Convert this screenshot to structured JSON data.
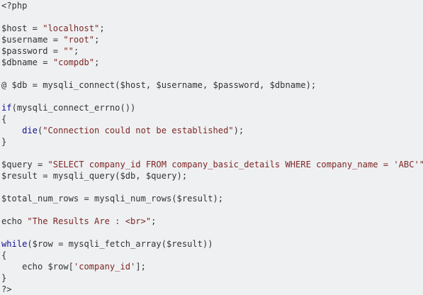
{
  "code": {
    "lines": [
      [
        {
          "t": "pln",
          "v": "<?php"
        }
      ],
      [],
      [
        {
          "t": "pln",
          "v": "$host = "
        },
        {
          "t": "str",
          "v": "\"localhost\""
        },
        {
          "t": "pln",
          "v": ";"
        }
      ],
      [
        {
          "t": "pln",
          "v": "$username = "
        },
        {
          "t": "str",
          "v": "\"root\""
        },
        {
          "t": "pln",
          "v": ";"
        }
      ],
      [
        {
          "t": "pln",
          "v": "$password = "
        },
        {
          "t": "str",
          "v": "\"\""
        },
        {
          "t": "pln",
          "v": ";"
        }
      ],
      [
        {
          "t": "pln",
          "v": "$dbname = "
        },
        {
          "t": "str",
          "v": "\"compdb\""
        },
        {
          "t": "pln",
          "v": ";"
        }
      ],
      [],
      [
        {
          "t": "pln",
          "v": "@ $db = mysqli_connect($host, $username, $password, $dbname);"
        }
      ],
      [],
      [
        {
          "t": "kw",
          "v": "if"
        },
        {
          "t": "pln",
          "v": "(mysqli_connect_errno())"
        }
      ],
      [
        {
          "t": "pln",
          "v": "{"
        }
      ],
      [
        {
          "t": "pln",
          "v": "    "
        },
        {
          "t": "kw",
          "v": "die"
        },
        {
          "t": "pln",
          "v": "("
        },
        {
          "t": "str",
          "v": "\"Connection could not be established\""
        },
        {
          "t": "pln",
          "v": ");"
        }
      ],
      [
        {
          "t": "pln",
          "v": "}"
        }
      ],
      [],
      [
        {
          "t": "pln",
          "v": "$query = "
        },
        {
          "t": "str",
          "v": "\"SELECT company_id FROM company_basic_details WHERE company_name = 'ABC'\""
        },
        {
          "t": "pln",
          "v": ";"
        }
      ],
      [
        {
          "t": "pln",
          "v": "$result = mysqli_query($db, $query);"
        }
      ],
      [],
      [
        {
          "t": "pln",
          "v": "$total_num_rows = mysqli_num_rows($result);"
        }
      ],
      [],
      [
        {
          "t": "pln",
          "v": "echo "
        },
        {
          "t": "str",
          "v": "\"The Results Are : <br>\""
        },
        {
          "t": "pln",
          "v": ";"
        }
      ],
      [],
      [
        {
          "t": "kw",
          "v": "while"
        },
        {
          "t": "pln",
          "v": "($row = mysqli_fetch_array($result))"
        }
      ],
      [
        {
          "t": "pln",
          "v": "{"
        }
      ],
      [
        {
          "t": "pln",
          "v": "    echo $row["
        },
        {
          "t": "str",
          "v": "'company_id'"
        },
        {
          "t": "pln",
          "v": "];"
        }
      ],
      [
        {
          "t": "pln",
          "v": "}"
        }
      ],
      [
        {
          "t": "pln",
          "v": "?>"
        }
      ]
    ]
  },
  "colors": {
    "background": "#eff0f1",
    "plain": "#303336",
    "keyword": "#101094",
    "string": "#7d2727"
  }
}
